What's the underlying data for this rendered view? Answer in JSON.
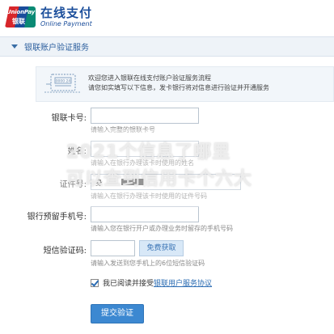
{
  "header": {
    "logo_badge_en": "UnionPay",
    "logo_badge_cn": "银联",
    "logo_cn": "在线支付",
    "logo_en": "Online Payment"
  },
  "panel": {
    "title": "银联账户验证服务",
    "notice_line1": "欢迎您进入银联在线支付账户验证服务流程",
    "notice_line2": "请您如实填写以下信息，发卡银行将对信息进行验证并开通服务"
  },
  "form": {
    "card_label": "银联卡号:",
    "card_hint": "请输入完整的银联卡号",
    "name_label": "姓名:",
    "name_hint": "请输入在银行办理该卡时使用的姓名",
    "id_label": "证件号:",
    "id_value": "身",
    "id_hint": "请输入在银行办理该卡时使用的证件号码",
    "phone_label": "银行预留手机号:",
    "phone_hint": "请输入您在银行开户或办理业务时留存的手机号码",
    "sms_label": "短信验证码:",
    "sms_button": "免费获取",
    "sms_hint": "请输入发送到您手机上的6位短信验证码",
    "agree_text": "我已阅读并接受",
    "agree_link": "银联用户服务协议",
    "submit": "提交验证"
  },
  "watermark": {
    "line1": "2021个信息了哪里",
    "line2": "可以查到信用卡个六大"
  },
  "colors": {
    "brand_blue": "#1b4e9b",
    "brand_red": "#d7262b",
    "brand_green": "#0a8a74",
    "link_blue": "#2b6cb3",
    "button_blue": "#3c88d1"
  }
}
